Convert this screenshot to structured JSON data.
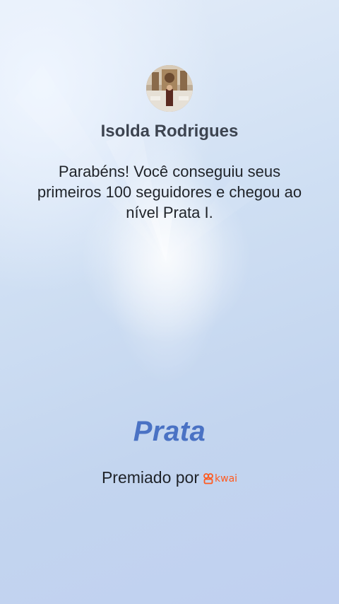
{
  "profile": {
    "name": "Isolda Rodrigues",
    "avatar_icon": "avatar-photo"
  },
  "message": {
    "text": "Parabéns! Você conseguiu seus primeiros 100 seguidores e chegou ao nível Prata I."
  },
  "badge": {
    "level": "Prata"
  },
  "award": {
    "text": "Premiado por",
    "brand_name": "kwai",
    "brand_icon": "kwai-logo-icon"
  },
  "colors": {
    "level_text": "#4a72c4",
    "brand": "#ff5a1f",
    "name_text": "#3d4450"
  }
}
